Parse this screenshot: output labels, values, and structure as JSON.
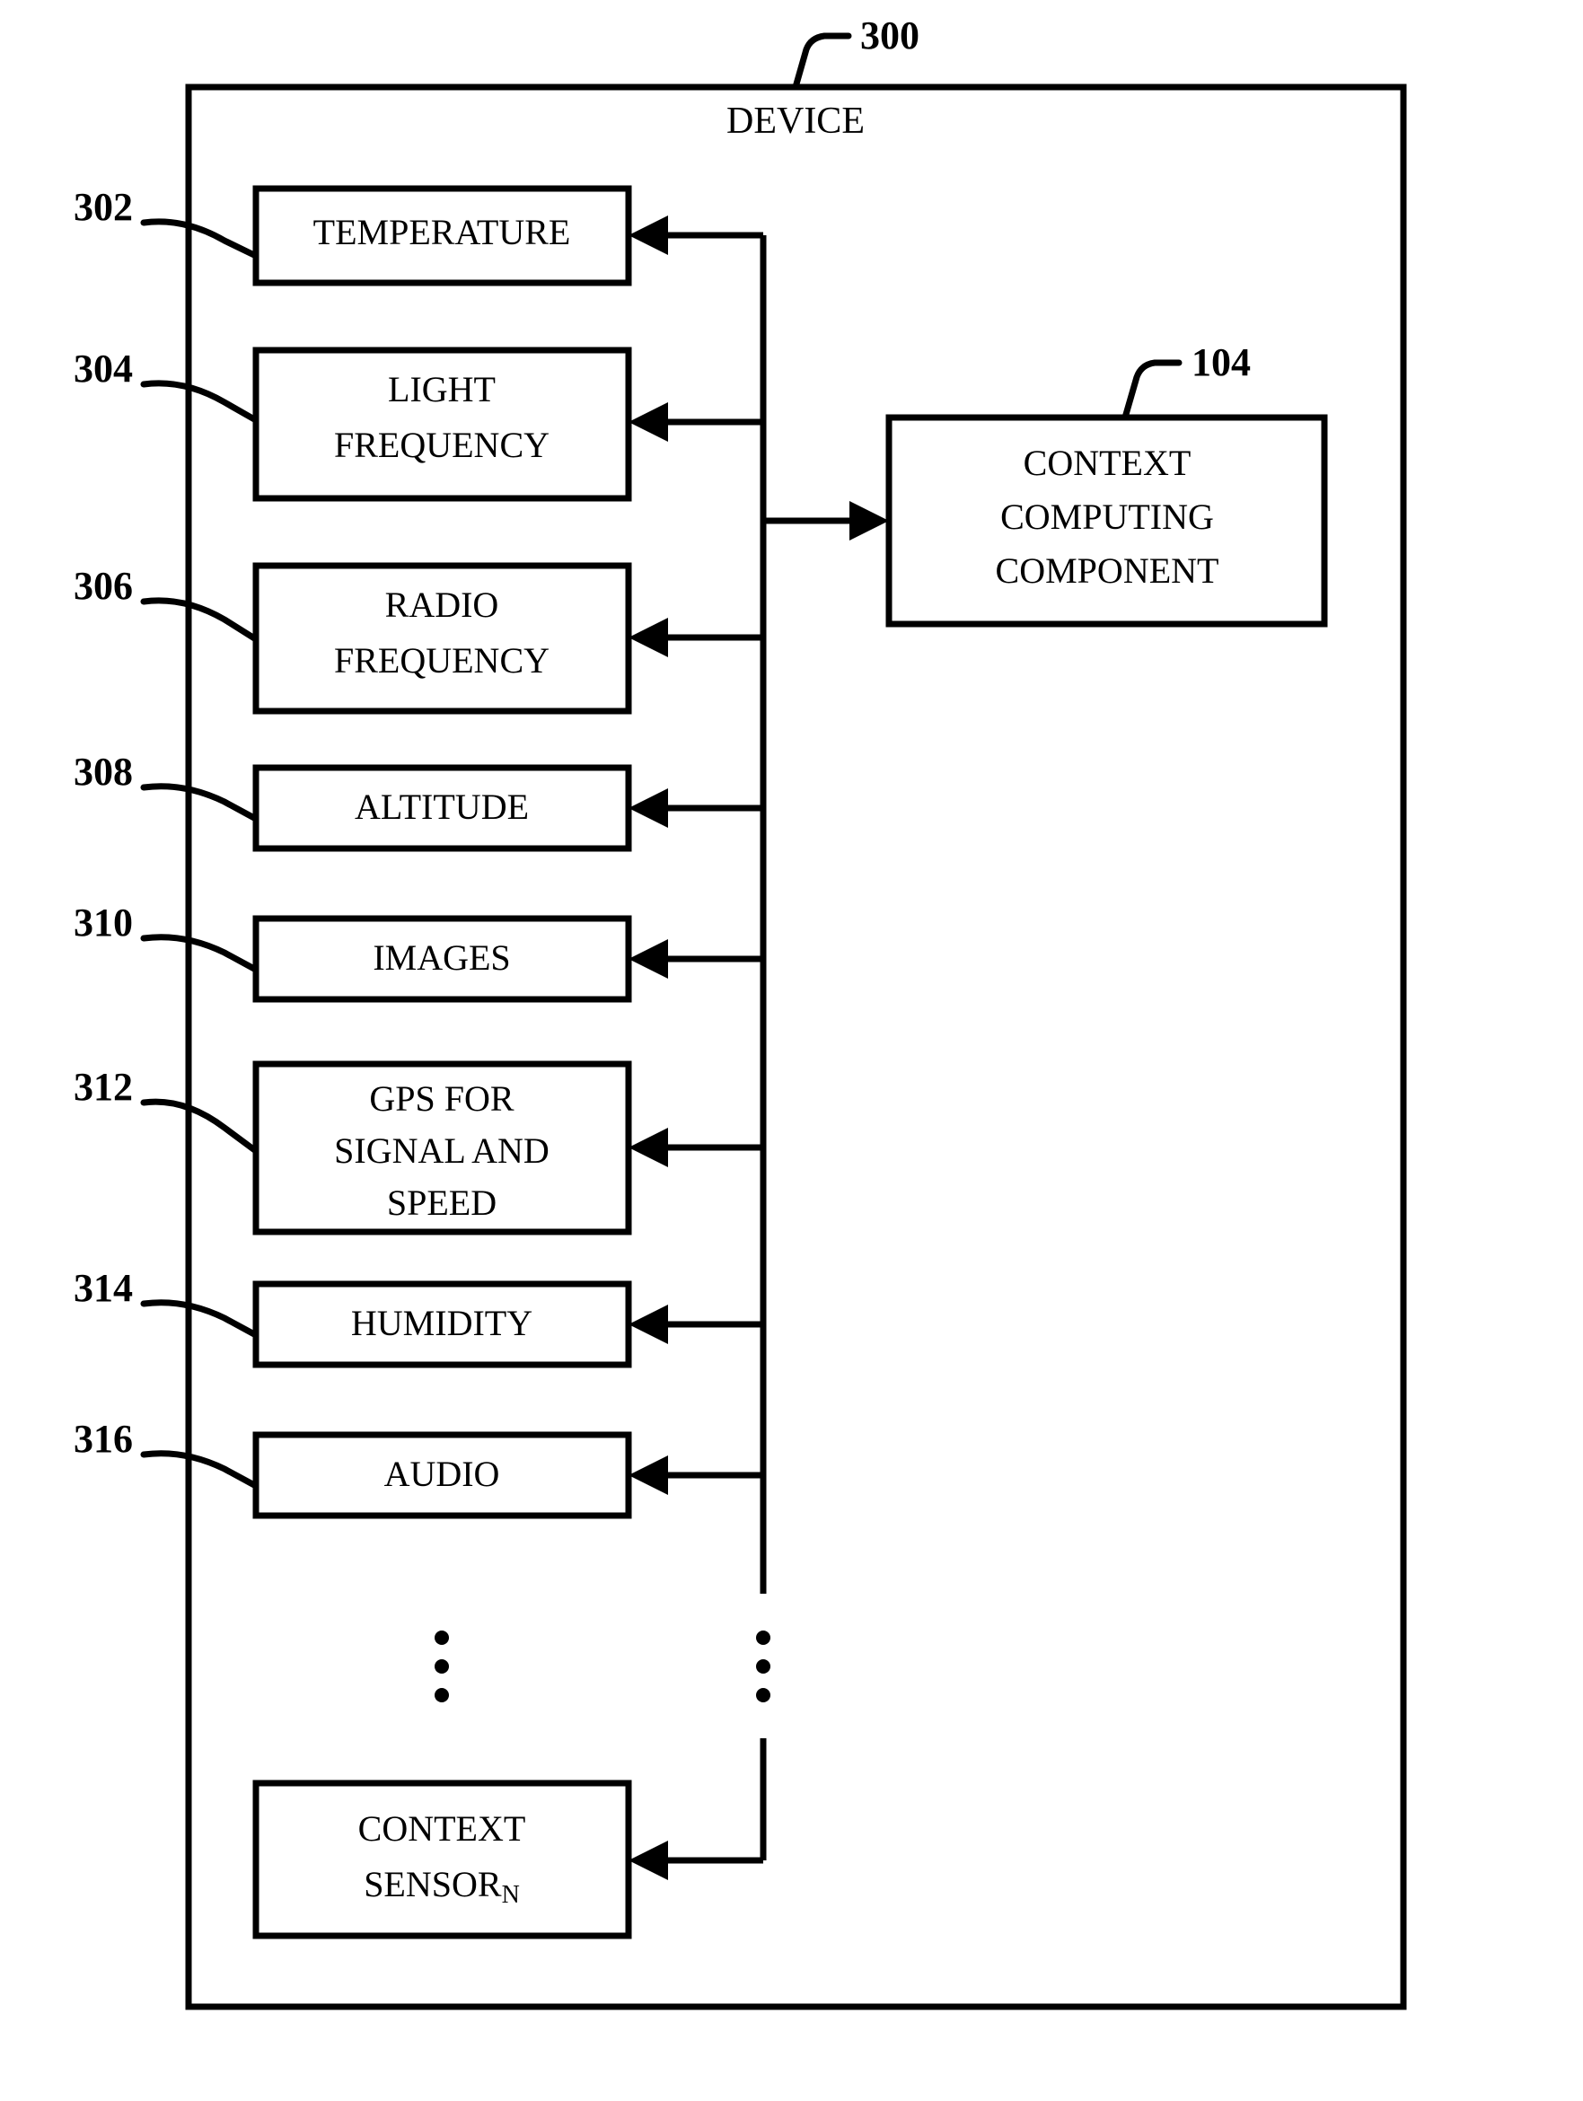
{
  "figure": {
    "device": {
      "title": "DEVICE",
      "ref": "300"
    },
    "context_component": {
      "label_line1": "CONTEXT",
      "label_line2": "COMPUTING",
      "label_line3": "COMPONENT",
      "ref": "104"
    },
    "sensors": [
      {
        "ref": "302",
        "lines": [
          "TEMPERATURE"
        ]
      },
      {
        "ref": "304",
        "lines": [
          "LIGHT",
          "FREQUENCY"
        ]
      },
      {
        "ref": "306",
        "lines": [
          "RADIO",
          "FREQUENCY"
        ]
      },
      {
        "ref": "308",
        "lines": [
          "ALTITUDE"
        ]
      },
      {
        "ref": "310",
        "lines": [
          "IMAGES"
        ]
      },
      {
        "ref": "312",
        "lines": [
          "GPS FOR",
          "SIGNAL AND",
          "SPEED"
        ]
      },
      {
        "ref": "314",
        "lines": [
          "HUMIDITY"
        ]
      },
      {
        "ref": "316",
        "lines": [
          "AUDIO"
        ]
      }
    ],
    "terminal_sensor": {
      "line1": "CONTEXT",
      "line2_main": "SENSOR",
      "line2_sub": "N"
    },
    "ellipsis": {
      "glyph": "⋮",
      "count": 3
    },
    "colors": {
      "stroke": "#000000",
      "background": "#ffffff"
    }
  }
}
